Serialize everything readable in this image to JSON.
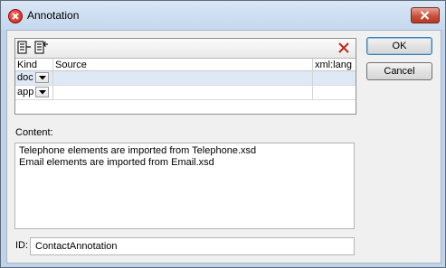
{
  "window": {
    "title": "Annotation"
  },
  "grid": {
    "columns": [
      "Kind",
      "Source",
      "xml:lang"
    ],
    "rows": [
      {
        "kind": "doc",
        "source": "",
        "lang": ""
      },
      {
        "kind": "app",
        "source": "",
        "lang": ""
      }
    ]
  },
  "content": {
    "label": "Content:",
    "lines": [
      "Telephone elements are imported from Telephone.xsd",
      "Email elements are imported from Email.xsd"
    ]
  },
  "id_field": {
    "label": "ID:",
    "value": "ContactAnnotation"
  },
  "buttons": {
    "ok": "OK",
    "cancel": "Cancel"
  },
  "colors": {
    "titlebar": "#c5d8ee",
    "delete_icon": "#c0221a",
    "selected_row": "#dfe9f6"
  }
}
